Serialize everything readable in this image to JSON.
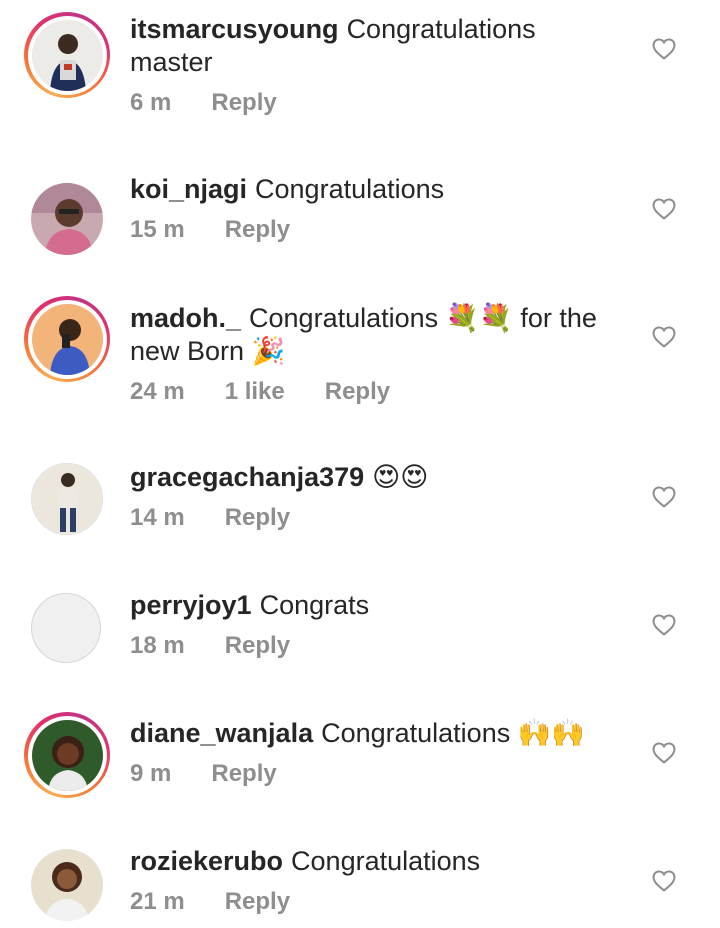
{
  "comments": [
    {
      "username": "itsmarcusyoung",
      "text": "Congratulations master",
      "time": "6 m",
      "likes": "",
      "reply": "Reply",
      "has_story_ring": true,
      "avatar_icon": "person-avatar"
    },
    {
      "username": "koi_njagi",
      "text": "Congratulations",
      "time": "15 m",
      "likes": "",
      "reply": "Reply",
      "has_story_ring": false,
      "avatar_icon": "person-avatar"
    },
    {
      "username": "madoh._",
      "text": "Congratulations 💐💐 for the new Born 🎉",
      "time": "24 m",
      "likes": "1 like",
      "reply": "Reply",
      "has_story_ring": true,
      "avatar_icon": "person-avatar"
    },
    {
      "username": "gracegachanja379",
      "text": "😍😍",
      "time": "14 m",
      "likes": "",
      "reply": "Reply",
      "has_story_ring": false,
      "avatar_icon": "person-avatar"
    },
    {
      "username": "perryjoy1",
      "text": "Congrats",
      "time": "18 m",
      "likes": "",
      "reply": "Reply",
      "has_story_ring": false,
      "avatar_icon": "empty-avatar"
    },
    {
      "username": "diane_wanjala",
      "text": "Congratulations 🙌🙌",
      "time": "9 m",
      "likes": "",
      "reply": "Reply",
      "has_story_ring": true,
      "avatar_icon": "person-avatar"
    },
    {
      "username": "roziekerubo",
      "text": "Congratulations",
      "time": "21 m",
      "likes": "",
      "reply": "Reply",
      "has_story_ring": false,
      "avatar_icon": "person-avatar"
    }
  ],
  "colors": {
    "text": "#262626",
    "meta": "#8e8e8e",
    "ring_start": "#fbad50",
    "ring_end": "#c13584"
  },
  "icons": {
    "like": "heart-outline-icon"
  }
}
